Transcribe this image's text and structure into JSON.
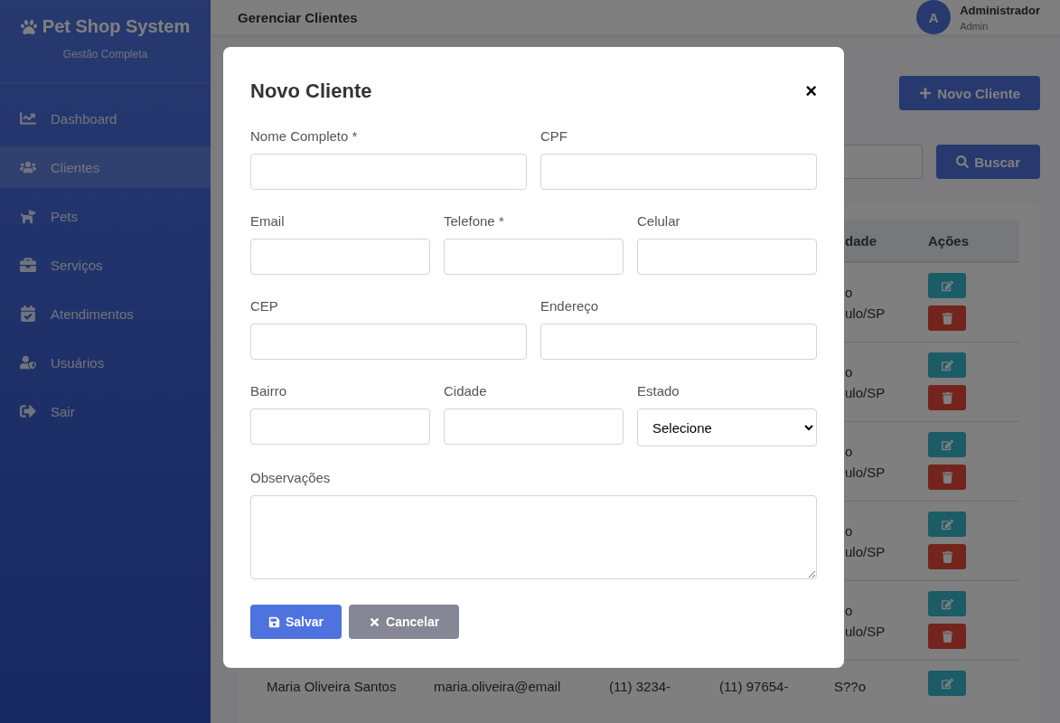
{
  "sidebar": {
    "brand": "Pet Shop System",
    "subtitle": "Gestão Completa",
    "items": [
      {
        "label": "Dashboard",
        "kind": "chart",
        "selected": false
      },
      {
        "label": "Clientes",
        "kind": "users",
        "selected": true
      },
      {
        "label": "Pets",
        "kind": "dog",
        "selected": false
      },
      {
        "label": "Serviços",
        "kind": "briefcase",
        "selected": false
      },
      {
        "label": "Atendimentos",
        "kind": "calendar",
        "selected": false
      },
      {
        "label": "Usuários",
        "kind": "usershield",
        "selected": false
      },
      {
        "label": "Sair",
        "kind": "logout",
        "selected": false
      }
    ]
  },
  "header": {
    "title": "Gerenciar Clientes",
    "user": {
      "initial": "A",
      "name": "Administrador",
      "role": "Admin"
    }
  },
  "toolbar": {
    "new_button": "Novo Cliente",
    "search_button": "Buscar"
  },
  "table": {
    "columns": [
      "dade",
      "Ações"
    ],
    "rows": [
      {
        "kind": "covered",
        "city": [
          "o",
          "ulo/SP"
        ],
        "actions": [
          {
            "kind": "edit"
          },
          {
            "kind": "delete"
          }
        ]
      },
      {
        "kind": "covered",
        "city": [
          "o",
          "ulo/SP"
        ],
        "actions": [
          {
            "kind": "edit"
          },
          {
            "kind": "delete"
          }
        ]
      },
      {
        "kind": "covered",
        "city": [
          "o",
          "ulo/SP"
        ],
        "actions": [
          {
            "kind": "edit"
          },
          {
            "kind": "delete"
          }
        ]
      },
      {
        "kind": "covered",
        "city": [
          "o",
          "ulo/SP"
        ],
        "actions": [
          {
            "kind": "edit"
          },
          {
            "kind": "delete"
          }
        ]
      },
      {
        "kind": "covered",
        "city": [
          "o",
          "ulo/SP"
        ],
        "actions": [
          {
            "kind": "edit"
          },
          {
            "kind": "delete"
          }
        ]
      },
      {
        "kind": "full",
        "name": "Maria Oliveira Santos",
        "email": "maria.oliveira@email",
        "phone": "(11) 3234-",
        "mobile": "(11) 97654-",
        "city": [
          "S??o"
        ],
        "actions": [
          {
            "kind": "edit"
          }
        ]
      }
    ]
  },
  "modal": {
    "title": "Novo Cliente",
    "close": "×",
    "rows": [
      [
        {
          "label": "Nome Completo *",
          "kind": "text"
        },
        {
          "label": "CPF",
          "kind": "text"
        }
      ],
      [
        {
          "label": "Email",
          "kind": "text"
        },
        {
          "label": "Telefone *",
          "kind": "text"
        },
        {
          "label": "Celular",
          "kind": "text"
        }
      ],
      [
        {
          "label": "CEP",
          "kind": "text"
        },
        {
          "label": "Endereço",
          "kind": "text"
        }
      ],
      [
        {
          "label": "Bairro",
          "kind": "text"
        },
        {
          "label": "Cidade",
          "kind": "text"
        },
        {
          "label": "Estado",
          "kind": "select",
          "value": "Selecione"
        }
      ]
    ],
    "notes": {
      "label": "Observações"
    },
    "buttons": [
      {
        "label": "Salvar",
        "kind": "primary"
      },
      {
        "label": "Cancelar",
        "kind": "secondary"
      }
    ]
  }
}
